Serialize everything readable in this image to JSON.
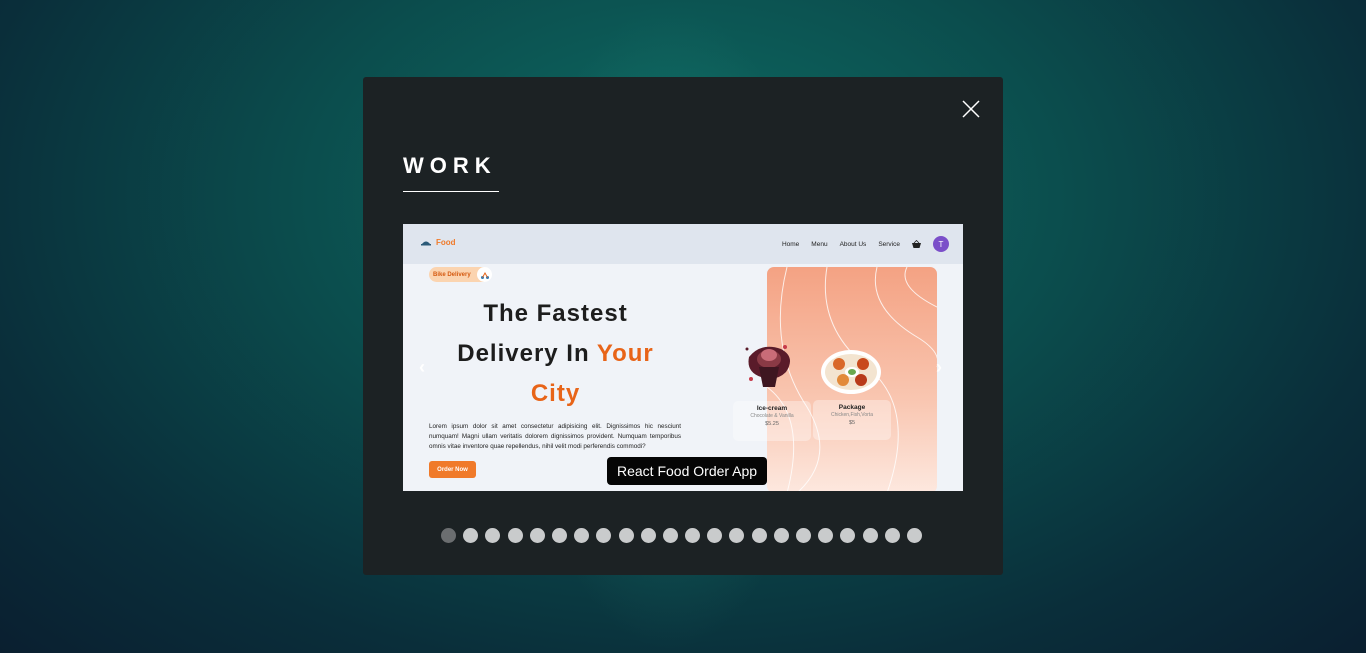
{
  "modal": {
    "title": "WORK",
    "close_icon": "close-icon"
  },
  "slide": {
    "nav": {
      "logo_text": "Food",
      "menu": [
        "Home",
        "Menu",
        "About Us",
        "Service"
      ],
      "avatar_letter": "T"
    },
    "badge_text": "Bike Delivery",
    "headline": {
      "line1": "The Fastest",
      "line2_plain": "Delivery In",
      "line2_accent": "Your",
      "line3_accent": "City"
    },
    "description": "Lorem ipsum dolor sit amet consectetur adipisicing elit. Dignissimos hic nesciunt numquam! Magni ullam veritatis dolorem dignissimos provident. Numquam temporibus omnis vitae inventore quae repellendus, nihil velit modi perferendis commodi?",
    "order_button": "Order Now",
    "cards": [
      {
        "name": "Ice-cream",
        "sub": "Chocolate & Vanilla",
        "price": "$5.25"
      },
      {
        "name": "Package",
        "sub": "Chicken,Fish,Vorta",
        "price": "$5"
      }
    ],
    "caption": "React Food Order App",
    "prev_arrow": "‹",
    "next_arrow": "›"
  },
  "pagination": {
    "count": 22,
    "active_index": 0
  },
  "colors": {
    "accent_orange": "#e86418",
    "modal_bg": "#1c2224",
    "avatar_purple": "#7b4fc9"
  }
}
